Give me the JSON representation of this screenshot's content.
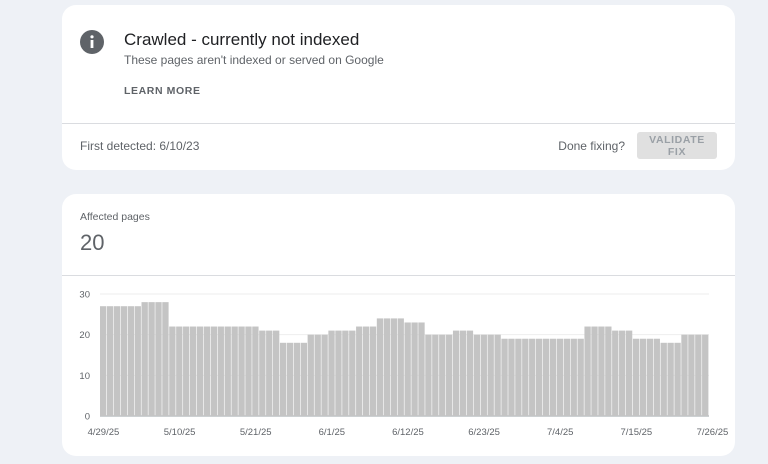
{
  "issue": {
    "title": "Crawled - currently not indexed",
    "subtitle": "These pages aren't indexed or served on Google",
    "learn_more": "LEARN MORE",
    "first_detected": "First detected: 6/10/23",
    "done_fixing": "Done fixing?",
    "validate_fix": "VALIDATE FIX"
  },
  "affected": {
    "label": "Affected pages",
    "value": "20"
  },
  "colors": {
    "bar": "#c4c4c4",
    "gridline": "#eeeeee",
    "axis": "#9aa0a6",
    "info_icon": "#5f6368"
  },
  "chart_data": {
    "type": "bar",
    "y_ticks": [
      "30",
      "20",
      "10",
      "0"
    ],
    "ylim": [
      0,
      30
    ],
    "x_tick_labels": [
      "4/29/25",
      "5/10/25",
      "5/21/25",
      "6/1/25",
      "6/12/25",
      "6/23/25",
      "7/4/25",
      "7/15/25",
      "7/26/25"
    ],
    "values": [
      27,
      27,
      27,
      27,
      27,
      27,
      28,
      28,
      28,
      28,
      22,
      22,
      22,
      22,
      22,
      22,
      22,
      22,
      22,
      22,
      22,
      22,
      22,
      21,
      21,
      21,
      18,
      18,
      18,
      18,
      20,
      20,
      20,
      21,
      21,
      21,
      21,
      22,
      22,
      22,
      24,
      24,
      24,
      24,
      23,
      23,
      23,
      20,
      20,
      20,
      20,
      21,
      21,
      21,
      20,
      20,
      20,
      20,
      19,
      19,
      19,
      19,
      19,
      19,
      19,
      19,
      19,
      19,
      19,
      19,
      22,
      22,
      22,
      22,
      21,
      21,
      21,
      19,
      19,
      19,
      19,
      18,
      18,
      18,
      20,
      20,
      20,
      20
    ],
    "grid": true,
    "legend": "none"
  }
}
